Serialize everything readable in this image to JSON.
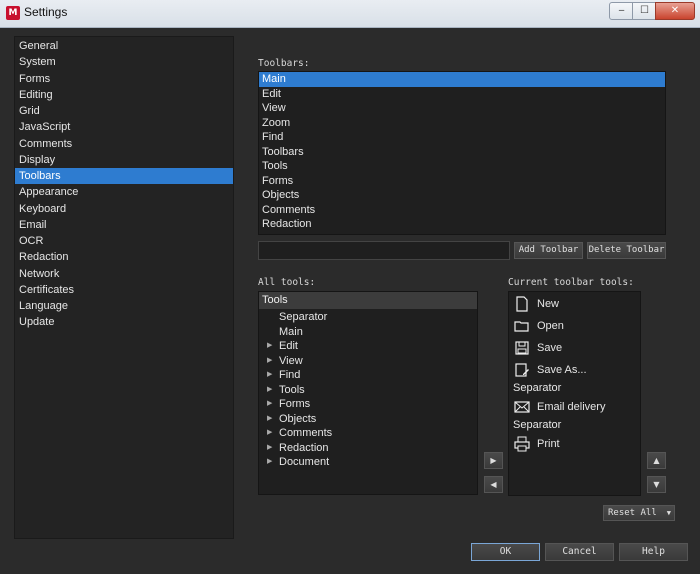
{
  "window": {
    "title": "Settings",
    "logo": "app-logo",
    "controls": {
      "minimize": "‒",
      "maximize": "☐",
      "close": "✕"
    }
  },
  "nav": {
    "items": [
      "General",
      "System",
      "Forms",
      "Editing",
      "Grid",
      "JavaScript",
      "Comments",
      "Display",
      "Toolbars",
      "Appearance",
      "Keyboard",
      "Email",
      "OCR",
      "Redaction",
      "Network",
      "Certificates",
      "Language",
      "Update"
    ],
    "selected": "Toolbars"
  },
  "toolbars": {
    "label": "Toolbars:",
    "items": [
      "Main",
      "Edit",
      "View",
      "Zoom",
      "Find",
      "Toolbars",
      "Tools",
      "Forms",
      "Objects",
      "Comments",
      "Redaction"
    ],
    "selected": "Main",
    "name_value": "",
    "add_label": "Add Toolbar",
    "delete_label": "Delete Toolbar"
  },
  "all_tools": {
    "label": "All tools:",
    "header": "Tools",
    "items": [
      {
        "label": "Separator",
        "expandable": false
      },
      {
        "label": "Main",
        "expandable": false
      },
      {
        "label": "Edit",
        "expandable": true
      },
      {
        "label": "View",
        "expandable": true
      },
      {
        "label": "Find",
        "expandable": true
      },
      {
        "label": "Tools",
        "expandable": true
      },
      {
        "label": "Forms",
        "expandable": true
      },
      {
        "label": "Objects",
        "expandable": true
      },
      {
        "label": "Comments",
        "expandable": true
      },
      {
        "label": "Redaction",
        "expandable": true
      },
      {
        "label": "Document",
        "expandable": true
      }
    ]
  },
  "current_tools": {
    "label": "Current toolbar tools:",
    "items": [
      {
        "label": "New",
        "icon": "new-document-icon"
      },
      {
        "label": "Open",
        "icon": "folder-open-icon"
      },
      {
        "label": "Save",
        "icon": "floppy-disk-icon"
      },
      {
        "label": "Save As...",
        "icon": "save-as-icon"
      },
      {
        "label": "Separator",
        "icon": ""
      },
      {
        "label": "Email delivery",
        "icon": "envelope-icon"
      },
      {
        "label": "Separator",
        "icon": ""
      },
      {
        "label": "Print",
        "icon": "printer-icon"
      }
    ]
  },
  "arrows": {
    "add": "▶",
    "remove": "◀",
    "up": "▲",
    "down": "▼"
  },
  "reset_label": "Reset All",
  "buttons": {
    "ok": "OK",
    "cancel": "Cancel",
    "help": "Help"
  },
  "colors": {
    "accent": "#2e7cd0",
    "background": "#2b2b2b",
    "list_bg": "#1f1f1f"
  }
}
